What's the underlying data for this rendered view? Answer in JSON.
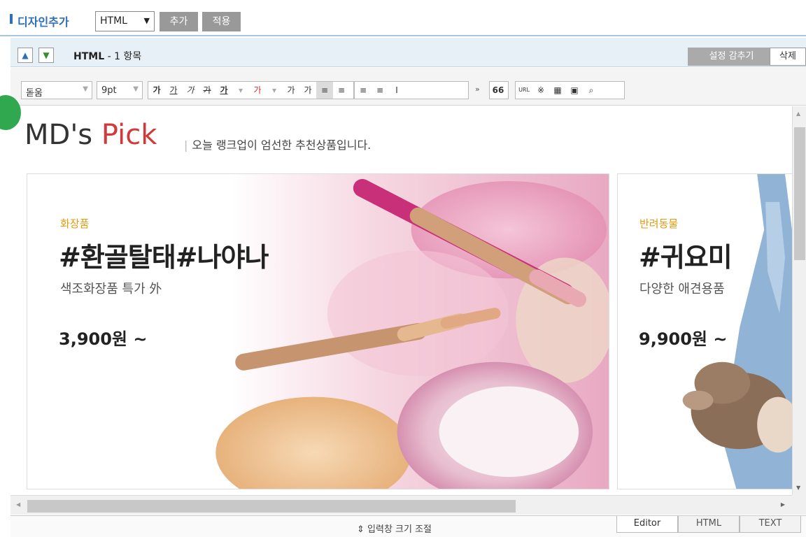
{
  "design_bar": {
    "title": "디자인추가",
    "type_select": "HTML",
    "add_button": "추가",
    "apply_button": "적용"
  },
  "item_row": {
    "label_type": "HTML",
    "label_rest": " - 1 항목",
    "hide_settings_button": "설정 감추기",
    "delete_button": "삭제"
  },
  "toolbar": {
    "font_select": "돋움",
    "size_select": "9pt",
    "buttons": [
      "가",
      "가",
      "가",
      "가",
      "가",
      "가",
      "가",
      "가",
      "≡",
      "≡",
      "≡",
      "≡",
      "I",
      "»",
      "66",
      "URL",
      "※",
      "▦",
      "▣",
      "⌕"
    ]
  },
  "content": {
    "heading_prefix": "MD's",
    "heading_pick": "Pick",
    "subtitle": "오늘 랭크업이 엄선한 추천상품입니다.",
    "cards": [
      {
        "category": "화장품",
        "tag": "#환골탈태#나야나",
        "desc": "색조화장품 특가 外",
        "price": "3,900원 ~"
      },
      {
        "category": "반려동물",
        "tag": "#귀요미",
        "desc": "다양한 애견용품",
        "price": "9,900원 ~"
      }
    ]
  },
  "bottom": {
    "resize_label": "⇕ 입력창 크기 조절",
    "tabs": [
      "Editor",
      "HTML",
      "TEXT"
    ]
  },
  "colors": {
    "accent_blue": "#2f6fb7",
    "pick_red": "#d13a3a",
    "category_orange": "#e29a10"
  }
}
